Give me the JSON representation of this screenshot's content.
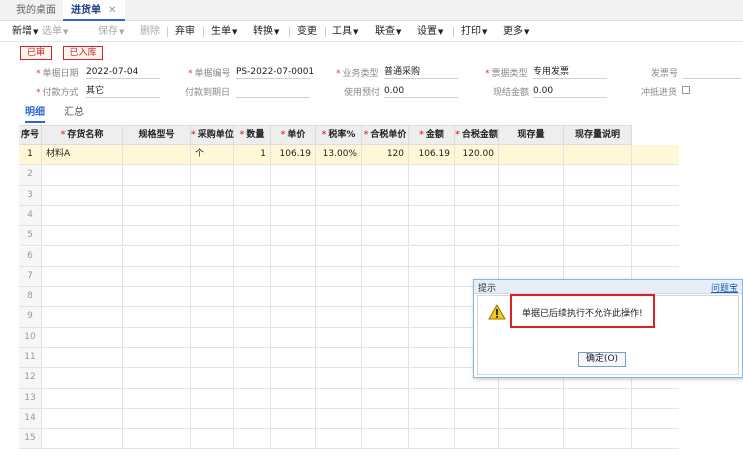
{
  "tabs": {
    "home": "我的桌面",
    "active": "进货单",
    "close": "✕"
  },
  "toolbar": [
    {
      "label": "新增",
      "caret": true,
      "disabled": false
    },
    {
      "label": "选单",
      "caret": true,
      "disabled": true
    },
    {
      "label": "保存",
      "caret": true,
      "disabled": true
    },
    {
      "label": "删除",
      "caret": false,
      "disabled": true
    },
    {
      "label": "弃审",
      "caret": false,
      "disabled": false
    },
    {
      "label": "生单",
      "caret": true,
      "disabled": false
    },
    {
      "label": "转换",
      "caret": true,
      "disabled": false
    },
    {
      "label": "变更",
      "caret": false,
      "disabled": false
    },
    {
      "label": "工具",
      "caret": true,
      "disabled": false
    },
    {
      "label": "联查",
      "caret": true,
      "disabled": false
    },
    {
      "label": "设置",
      "caret": true,
      "disabled": false
    },
    {
      "label": "打印",
      "caret": true,
      "disabled": false
    },
    {
      "label": "更多",
      "caret": true,
      "disabled": false
    }
  ],
  "stamps": {
    "audited": "已审",
    "stocked": "已入库"
  },
  "form": {
    "doc_date_label": "单据日期",
    "doc_date": "2022-07-04",
    "doc_no_label": "单据编号",
    "doc_no": "PS-2022-07-0001",
    "biz_type_label": "业务类型",
    "biz_type": "普通采购",
    "invoice_type_label": "票据类型",
    "invoice_type": "专用发票",
    "invoice_no_label": "发票号",
    "invoice_no": "",
    "pay_method_label": "付款方式",
    "pay_method": "其它",
    "pay_due_label": "付款到期日",
    "pay_due": "",
    "prepay_label": "使用预付",
    "prepay": "0.00",
    "cash_label": "现结金额",
    "cash": "0.00",
    "offset_label": "冲抵进货"
  },
  "subtabs": {
    "detail": "明细",
    "summary": "汇总"
  },
  "grid": {
    "headers": [
      "序号",
      "存货名称",
      "规格型号",
      "采购单位",
      "数量",
      "单价",
      "税率%",
      "合税单价",
      "金额",
      "合税金额",
      "现存量",
      "现存量说明"
    ],
    "required": [
      false,
      true,
      false,
      true,
      true,
      true,
      true,
      true,
      true,
      true,
      false,
      false
    ],
    "rows": [
      [
        "1",
        "材料A",
        "",
        "个",
        "1",
        "106.19",
        "13.00%",
        "120",
        "106.19",
        "120.00",
        "",
        ""
      ],
      [
        "2"
      ],
      [
        "3"
      ],
      [
        "4"
      ],
      [
        "5"
      ],
      [
        "6"
      ],
      [
        "7"
      ],
      [
        "8"
      ],
      [
        "9"
      ],
      [
        "10"
      ],
      [
        "11"
      ],
      [
        "12"
      ],
      [
        "13"
      ],
      [
        "14"
      ],
      [
        "15"
      ]
    ]
  },
  "dialog": {
    "title": "提示",
    "help": "问题宝",
    "message": "单据已后续执行不允许此操作!",
    "ok": "确定(O)"
  },
  "colors": {
    "accent": "#2f66d0",
    "danger": "#e02020",
    "selected_row": "#fff7d6"
  }
}
